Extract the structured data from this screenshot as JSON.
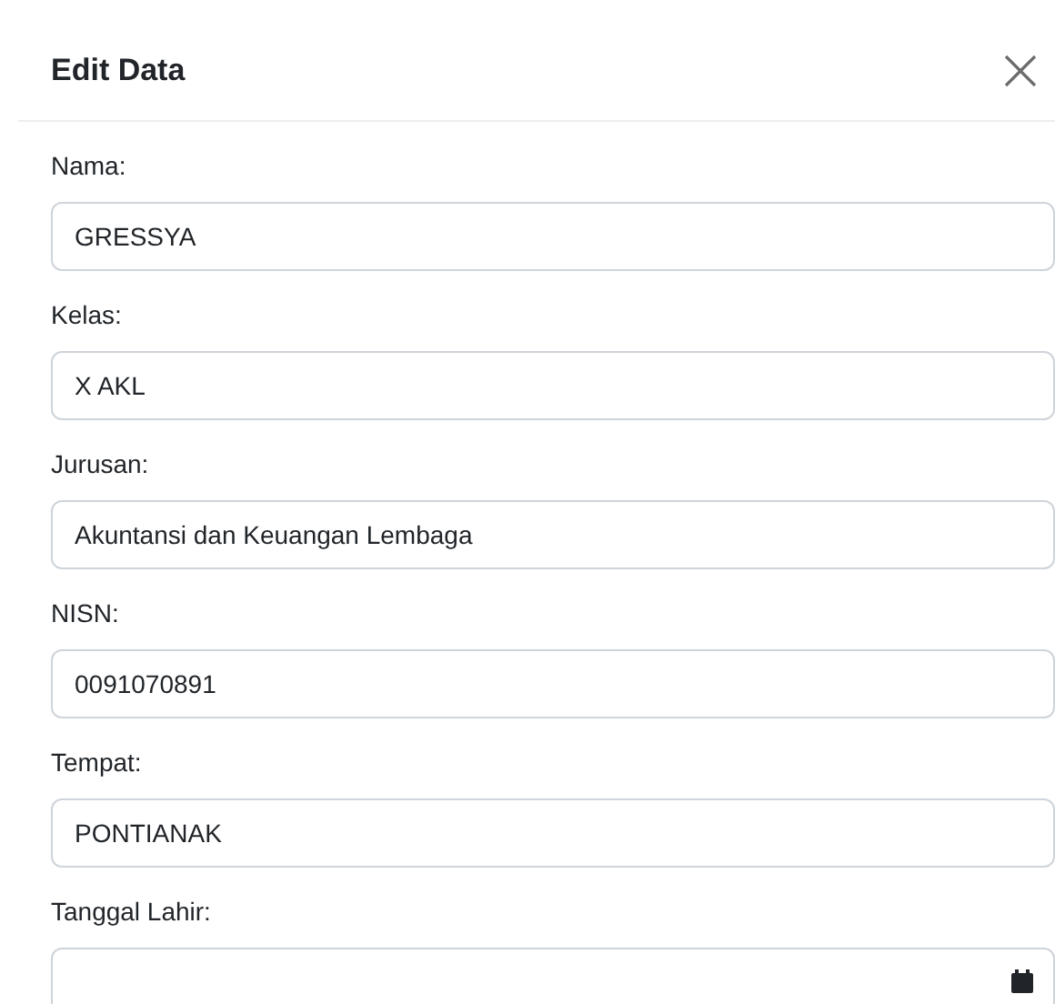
{
  "modal": {
    "title": "Edit Data"
  },
  "fields": [
    {
      "label": "Nama:",
      "value": "GRESSYA",
      "kind": "text"
    },
    {
      "label": "Kelas:",
      "value": "X AKL",
      "kind": "text"
    },
    {
      "label": "Jurusan:",
      "value": "Akuntansi dan Keuangan Lembaga",
      "kind": "text"
    },
    {
      "label": "NISN:",
      "value": "0091070891",
      "kind": "text"
    },
    {
      "label": "Tempat:",
      "value": "PONTIANAK",
      "kind": "text"
    },
    {
      "label": "Tanggal Lahir:",
      "kind": "date"
    }
  ]
}
